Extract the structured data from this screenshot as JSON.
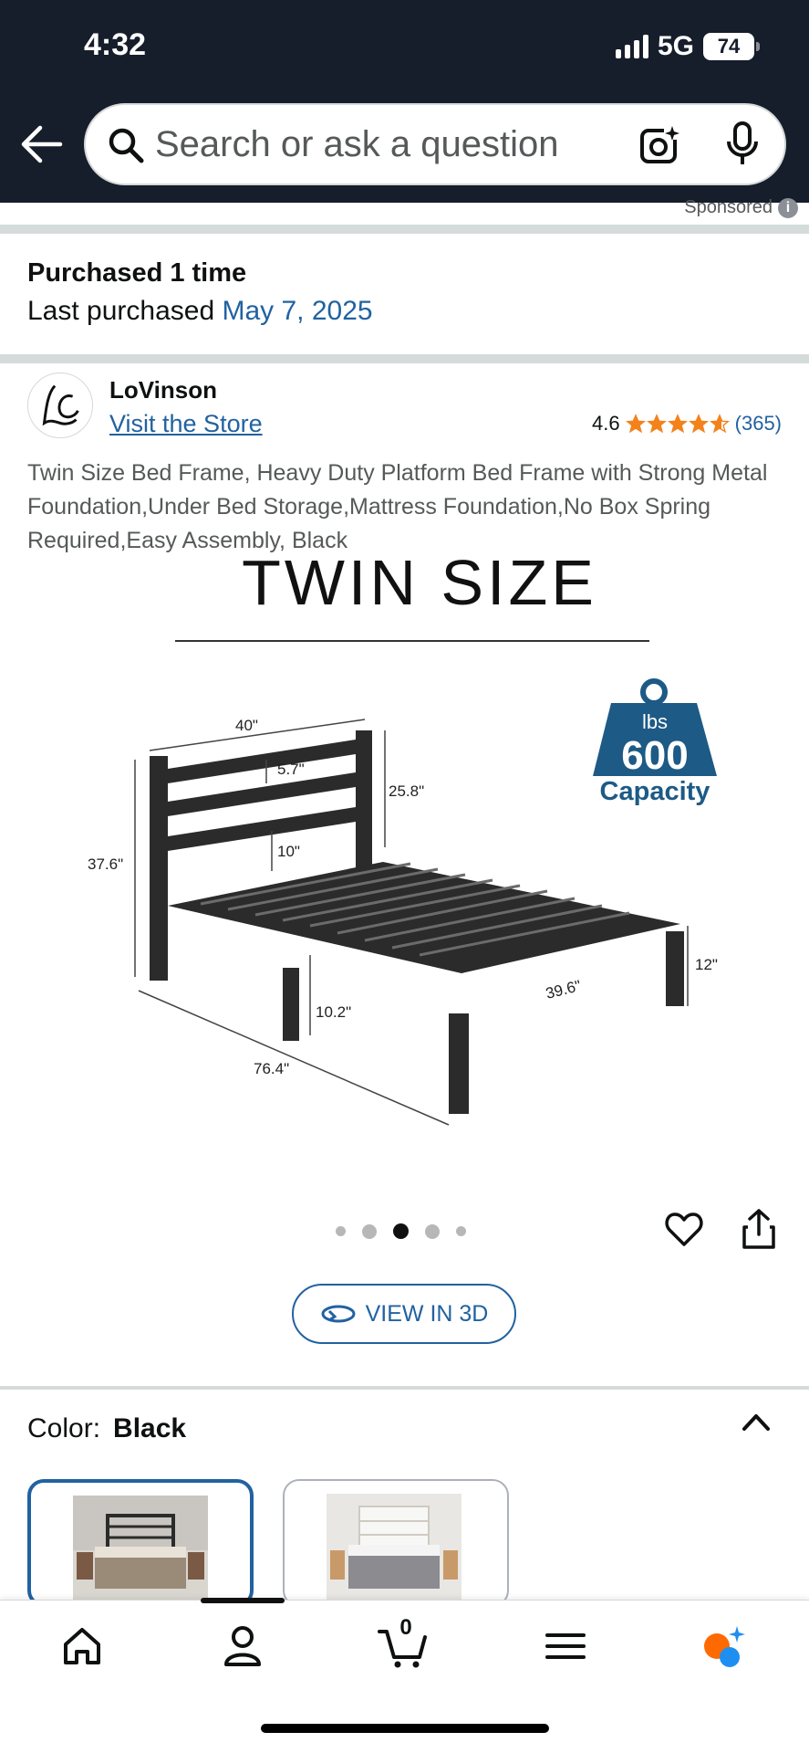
{
  "status_bar": {
    "time": "4:32",
    "network": "5G",
    "battery": "74"
  },
  "search": {
    "placeholder": "Search or ask a question"
  },
  "sponsored_label": "Sponsored",
  "purchase": {
    "title": "Purchased 1 time",
    "last_label": "Last purchased",
    "last_date": "May 7, 2025"
  },
  "brand": {
    "name": "LoVinson",
    "visit_store": "Visit the Store",
    "rating": "4.6",
    "stars": 4.6,
    "review_count": "(365)"
  },
  "product": {
    "title": "Twin Size Bed Frame, Heavy Duty Platform Bed Frame with Strong Metal Foundation,Under Bed Storage,Mattress Foundation,No Box Spring Required,Easy Assembly, Black",
    "image": {
      "heading": "TWIN SIZE",
      "dims": {
        "width": "40\"",
        "rail_gap": "5.7\"",
        "headboard_height": "25.8\"",
        "lower_gap": "10\"",
        "total_height": "37.6\"",
        "frame_height": "12\"",
        "clearance": "10.2\"",
        "length": "76.4\"",
        "side_width": "39.6\""
      },
      "badge": {
        "unit": "lbs",
        "value": "600",
        "label": "Capacity"
      }
    },
    "carousel": {
      "count": 5,
      "active_index": 2
    },
    "view_3d_label": "VIEW IN 3D"
  },
  "color": {
    "label": "Color:",
    "value": "Black",
    "options": [
      "Black",
      "White"
    ]
  },
  "bottom_nav": {
    "items": [
      "home-icon",
      "account-icon",
      "cart-icon",
      "menu-icon",
      "rufus-icon"
    ],
    "cart_count": "0",
    "active_index": 1
  },
  "colors": {
    "accent": "#2162a1",
    "header_bg": "#161d2b",
    "star": "#f3821b",
    "badge_blue": "#1d5a86"
  }
}
